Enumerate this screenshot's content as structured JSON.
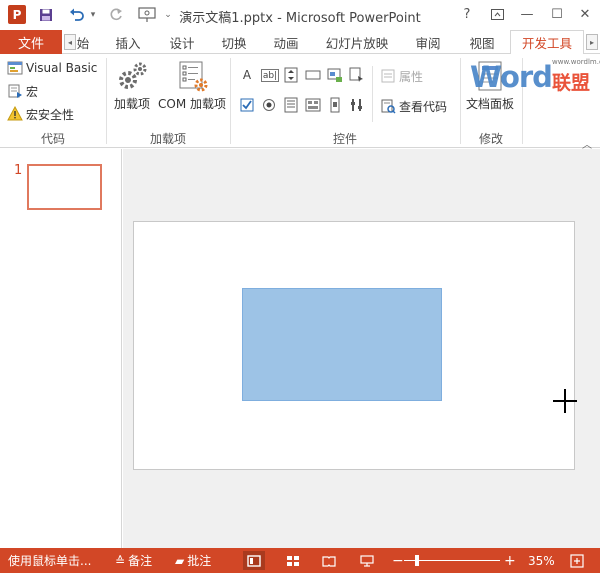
{
  "title_bar": {
    "app_logo": "P",
    "document_title": "演示文稿1.pptx - Microsoft PowerPoint",
    "help": "?",
    "restore": "⧉",
    "minimize": "—",
    "maximize": "☐",
    "close": "✕",
    "customize": "⌄"
  },
  "tabs": {
    "file": "文件",
    "scroll_left": "◂",
    "scroll_right": "▸",
    "items": [
      "始",
      "插入",
      "设计",
      "切换",
      "动画",
      "幻灯片放映",
      "审阅",
      "视图",
      "开发工具"
    ],
    "active_index": 8
  },
  "ribbon": {
    "code_group": {
      "label": "代码",
      "visual_basic": "Visual Basic",
      "macros": "宏",
      "macro_security": "宏安全性"
    },
    "addins_group": {
      "label": "加载项",
      "addins": "加载项",
      "com_addins": "COM 加载项"
    },
    "controls_group": {
      "label": "控件",
      "properties": "属性",
      "view_code": "查看代码",
      "label_control": "A",
      "textbox_control": "ab|"
    },
    "modify_group": {
      "label": "修改",
      "document_panel": "文档面板"
    },
    "watermark": {
      "word": "Word",
      "cn": "联盟",
      "url": "www.wordlm.com"
    }
  },
  "thumbnails": {
    "slide_number": "1"
  },
  "status_bar": {
    "hint": "使用鼠标单击...",
    "notes": "备注",
    "comments": "批注",
    "zoom_minus": "−",
    "zoom_plus": "+",
    "zoom": "35%",
    "zoom_level": 0.35
  },
  "colors": {
    "accent": "#d24726",
    "shape_fill": "#9dc3e6",
    "editor_bg": "#f0f0f0"
  }
}
